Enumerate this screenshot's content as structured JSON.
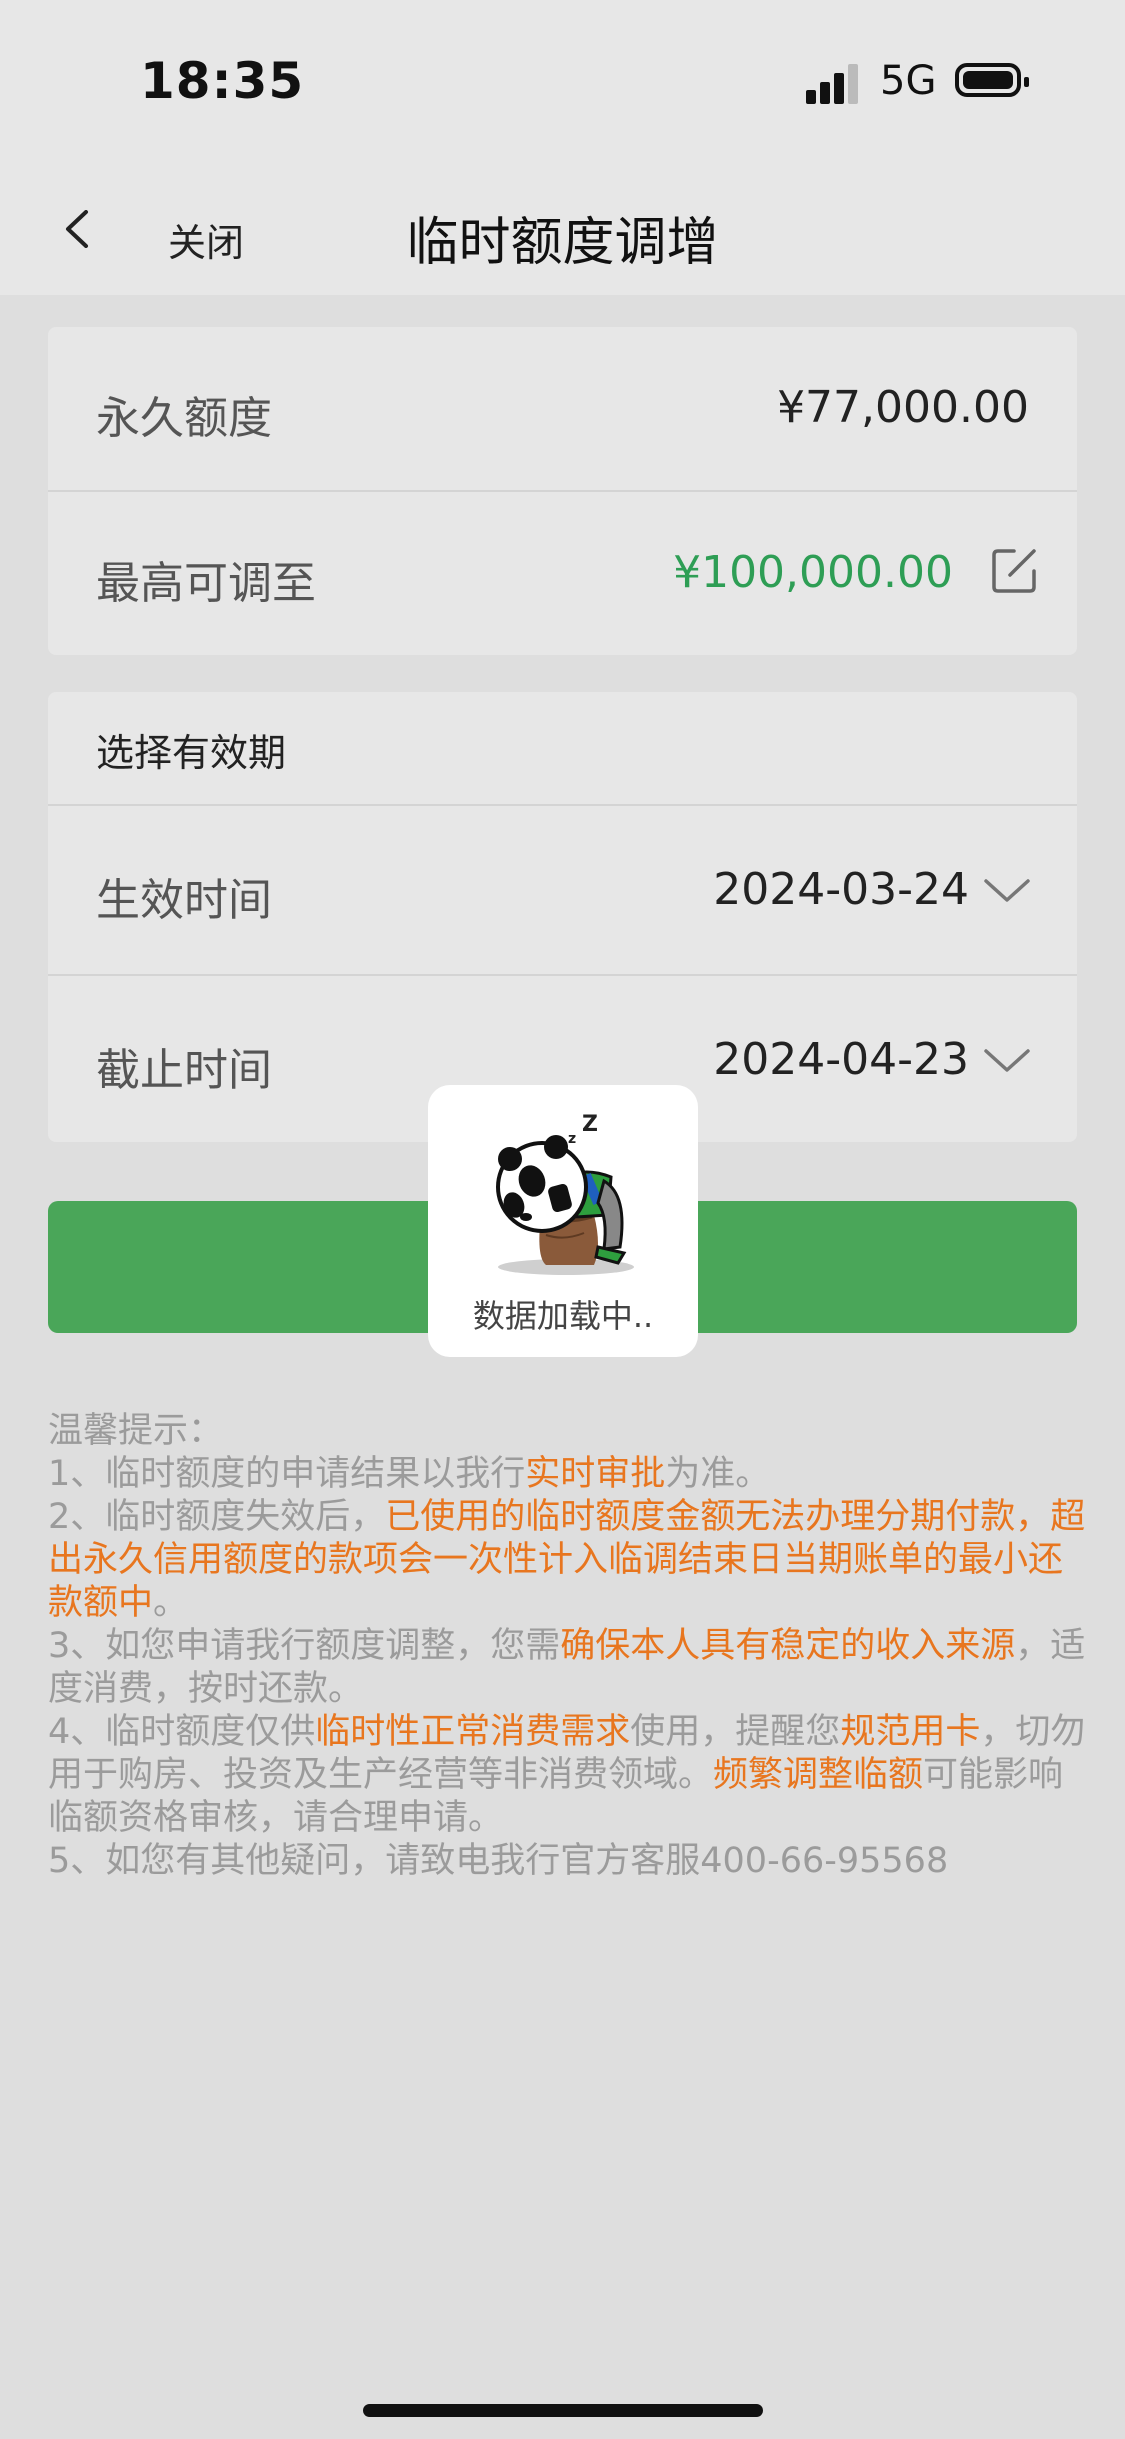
{
  "status_bar": {
    "time": "18:35",
    "network": "5G"
  },
  "nav": {
    "close_label": "关闭",
    "title": "临时额度调增"
  },
  "limits": {
    "permanent_label": "永久额度",
    "permanent_value": "¥77,000.00",
    "max_label": "最高可调至",
    "max_value": "¥100,000.00"
  },
  "validity": {
    "section_title": "选择有效期",
    "start_label": "生效时间",
    "start_value": "2024-03-24",
    "end_label": "截止时间",
    "end_value": "2024-04-23"
  },
  "loading": {
    "text": "数据加载中.."
  },
  "tips": {
    "title": "温馨提示：",
    "t1_a": "1、临时额度的申请结果以我行",
    "t1_b": "实时审批",
    "t1_c": "为准。",
    "t2_a": "2、临时额度失效后，",
    "t2_b": "已使用的临时额度金额无法办理分期付款，超出永久信用额度的款项会一次性计入临调结束日当期账单的最小还款额中",
    "t2_c": "。",
    "t3_a": "3、如您申请我行额度调整，您需",
    "t3_b": "确保本人具有稳定的收入来源",
    "t3_c": "，适度消费，按时还款。",
    "t4_a": "4、临时额度仅供",
    "t4_b": "临时性正常消费需求",
    "t4_c": "使用，提醒您",
    "t4_d": "规范用卡",
    "t4_e": "，切勿用于购房、投资及生产经营等非消费领域。",
    "t4_f": "频繁调整临额",
    "t4_g": "可能影响临额资格审核，请合理申请。",
    "t5": "5、如您有其他疑问，请致电我行官方客服400-66-95568"
  },
  "colors": {
    "accent_green": "#4aa659",
    "amount_green": "#2e9e55",
    "highlight_orange": "#e8761f"
  }
}
